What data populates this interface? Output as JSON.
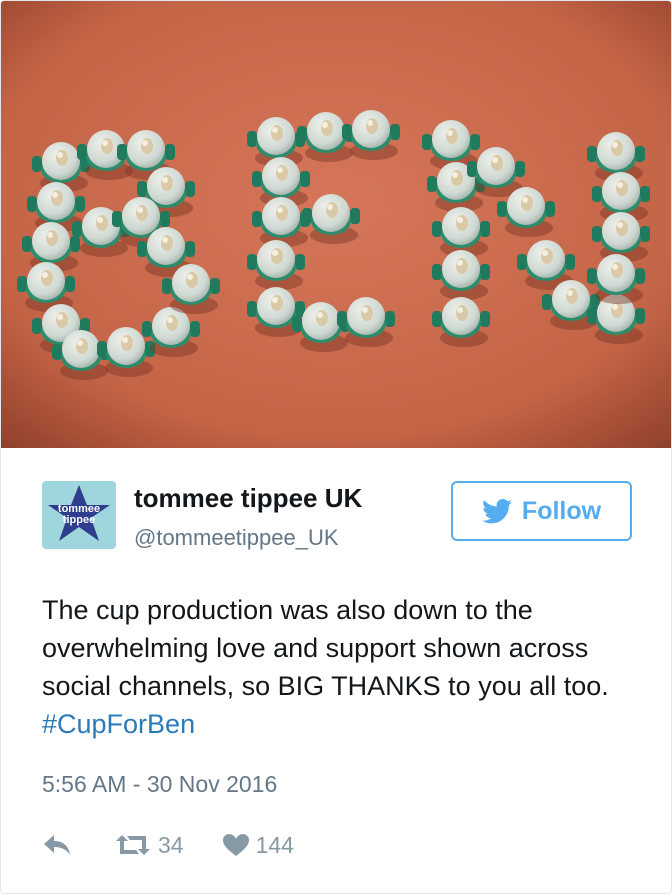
{
  "media": {
    "description_icon": "photo-cups-spelling-name"
  },
  "author": {
    "avatar_icon": "tommee-tippee-star-logo",
    "avatar_brand_line1": "tommee",
    "avatar_brand_line2": "tippee",
    "display_name": "tommee tippee UK",
    "handle": "@tommeetippee_UK"
  },
  "follow_button": {
    "label": "Follow",
    "icon": "twitter-bird-icon"
  },
  "tweet": {
    "text": "The cup production was also down to the overwhelming love and support shown across social channels, so BIG THANKS to you all too. ",
    "hashtag": "#CupForBen",
    "timestamp": "5:56 AM - 30 Nov 2016"
  },
  "actions": {
    "reply_icon": "reply-icon",
    "retweet_icon": "retweet-icon",
    "retweet_count": "34",
    "like_icon": "heart-icon",
    "like_count": "144"
  },
  "colors": {
    "accent": "#55acee",
    "hashtag": "#2b7bb9",
    "muted": "#657786",
    "icon": "#8899a6",
    "carpet": "#c9684a",
    "avatar_bg": "#9fd6dd",
    "logo_star": "#2e3d8c"
  }
}
